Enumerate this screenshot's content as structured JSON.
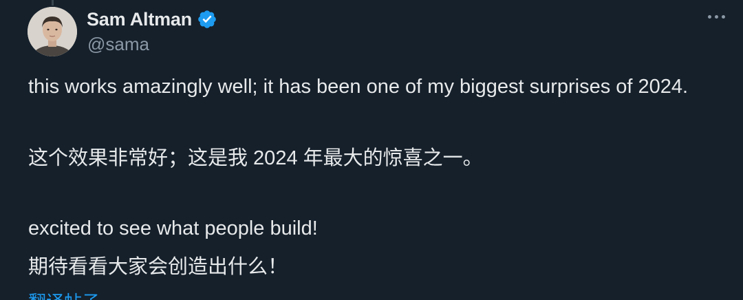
{
  "author": {
    "display_name": "Sam Altman",
    "handle": "@sama",
    "verified_badge": "verified-badge-icon",
    "avatar": "avatar-photo"
  },
  "tweet": {
    "line_en_1": "this works amazingly well; it has been one of my biggest surprises of 2024.",
    "line_zh_1": "这个效果非常好；这是我 2024 年最大的惊喜之一。",
    "line_en_2": "excited to see what people build!",
    "line_zh_2": "期待看看大家会创造出什么！"
  },
  "actions": {
    "more_icon": "more-options-icon",
    "translate_label": "翻译帖子"
  },
  "colors": {
    "background": "#15202b",
    "text": "#e7e9ea",
    "muted": "#8b98a5",
    "accent": "#1d9bf0"
  }
}
